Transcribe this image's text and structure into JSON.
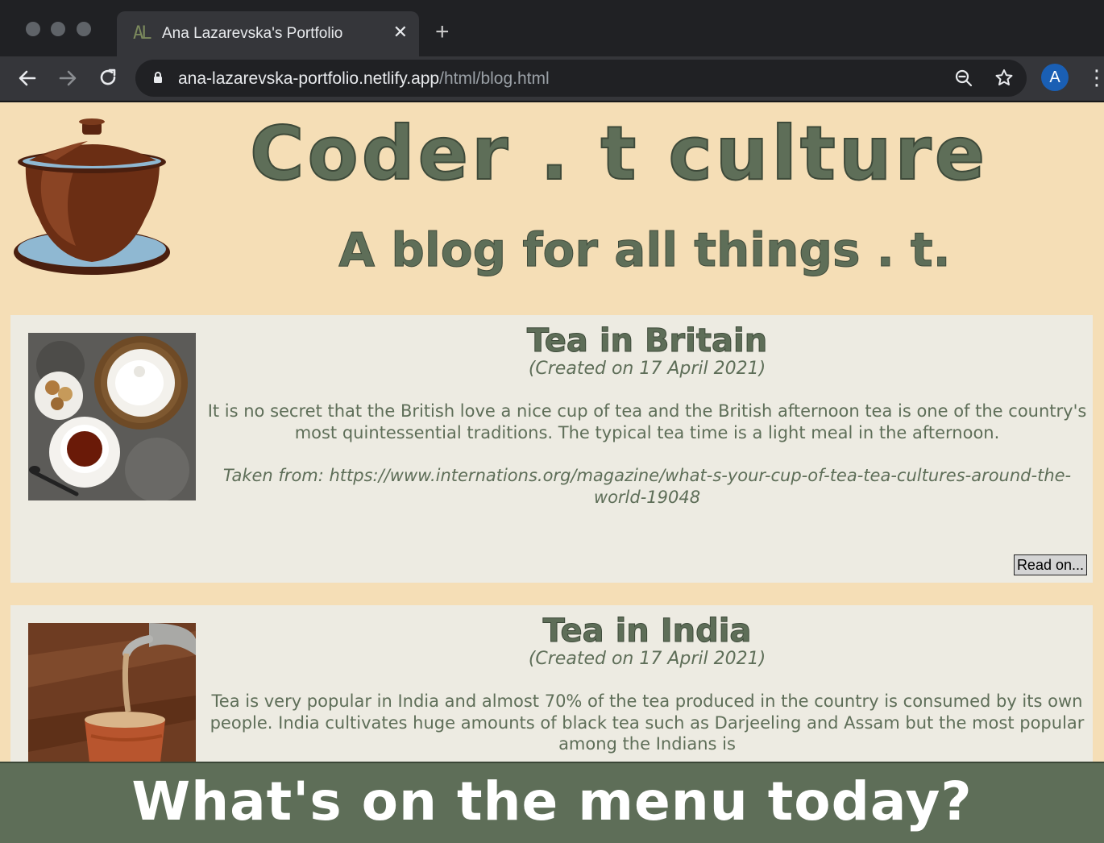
{
  "browser": {
    "tab_favicon": "AL",
    "tab_title": "Ana Lazarevska's Portfolio",
    "url_domain": "ana-lazarevska-portfolio.netlify.app",
    "url_path": "/html/blog.html",
    "avatar_letter": "A"
  },
  "header": {
    "title": "Coder . t culture",
    "subtitle": "A blog for all things . t."
  },
  "posts": [
    {
      "title": "Tea in Britain",
      "date": "(Created on 17 April 2021)",
      "text": "It is no secret that the British love a nice cup of tea and the British afternoon tea is one of the country's most quintessential traditions. The typical tea time is a light meal in the afternoon.",
      "source": "Taken from: https://www.internations.org/magazine/what-s-your-cup-of-tea-tea-cultures-around-the-world-19048",
      "button": "Read on..."
    },
    {
      "title": "Tea in India",
      "date": "(Created on 17 April 2021)",
      "text": "Tea is very popular in India and almost 70% of the tea produced in the country is consumed by its own people. India cultivates huge amounts of black tea such as Darjeeling and Assam but the most popular among the Indians is"
    }
  ],
  "footer": {
    "text": "What's on the menu today?"
  },
  "colors": {
    "page_bg": "#f5deb6",
    "accent_green": "#5e6e58",
    "card_bg": "#edebe2"
  }
}
